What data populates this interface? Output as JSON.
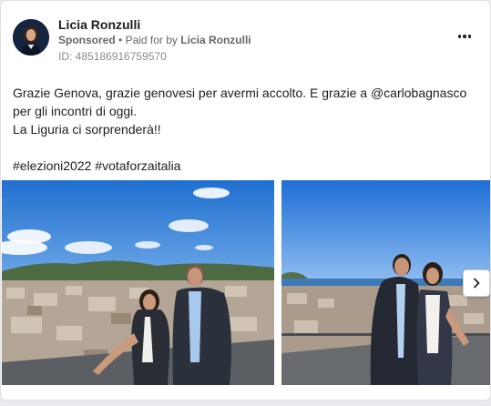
{
  "post": {
    "page_name": "Licia Ronzulli",
    "sponsored_label": "Sponsored",
    "separator": "•",
    "paid_for_prefix": "Paid for by",
    "paid_for_by": "Licia Ronzulli",
    "ad_id": "ID: 485186916759570",
    "more_icon": "more-horizontal-icon",
    "text_lines": [
      "Grazie Genova, grazie genovesi per avermi accolto. E grazie a @carlobagnasco per gli incontri di oggi.",
      "La Liguria ci sorprenderà!!",
      "#elezioni2022 #votaforzaitalia"
    ]
  },
  "carousel": {
    "photos": [
      {
        "name": "photo-genova-rooftop-1"
      },
      {
        "name": "photo-genova-rooftop-2"
      }
    ],
    "next_icon": "chevron-right-icon"
  },
  "colors": {
    "text": "#1c1e21",
    "secondary_text": "#65676b",
    "border": "#dddfe2",
    "sky": "#2d7fd6"
  }
}
